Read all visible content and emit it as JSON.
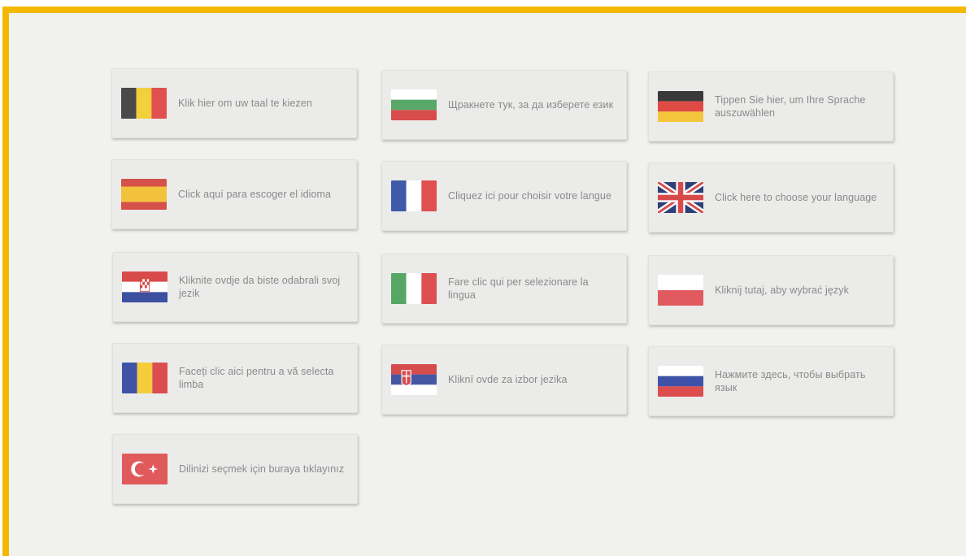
{
  "languages": [
    {
      "flag": "belgium-flag-icon",
      "label": "Klik hier om uw taal te kiezen"
    },
    {
      "flag": "bulgaria-flag-icon",
      "label": "Щракнете тук, за да изберете език"
    },
    {
      "flag": "germany-flag-icon",
      "label": "Tippen Sie hier, um Ihre Sprache auszuwählen"
    },
    {
      "flag": "spain-flag-icon",
      "label": "Click aquí para escoger el idioma"
    },
    {
      "flag": "france-flag-icon",
      "label": "Cliquez ici pour choisir votre langue"
    },
    {
      "flag": "uk-flag-icon",
      "label": "Click here to choose your language"
    },
    {
      "flag": "croatia-flag-icon",
      "label": "Kliknite ovdje da biste odabrali svoj jezik"
    },
    {
      "flag": "italy-flag-icon",
      "label": "Fare clic qui per selezionare la lingua"
    },
    {
      "flag": "poland-flag-icon",
      "label": "Kliknij tutaj, aby wybrać język"
    },
    {
      "flag": "romania-flag-icon",
      "label": "Faceți clic aici pentru a vă selecta limba"
    },
    {
      "flag": "serbia-flag-icon",
      "label": "Kliknī ovde za izbor jezika"
    },
    {
      "flag": "russia-flag-icon",
      "label": "Нажмите здесь, чтобы выбрать язык"
    },
    {
      "flag": "turkey-flag-icon",
      "label": "Dilinizi seçmek için buraya tıklayınız"
    }
  ],
  "colors": {
    "frame_border": "#f5b800",
    "background": "#f1f1ee",
    "tile": "#ebebea",
    "text": "#8a8a8a"
  }
}
